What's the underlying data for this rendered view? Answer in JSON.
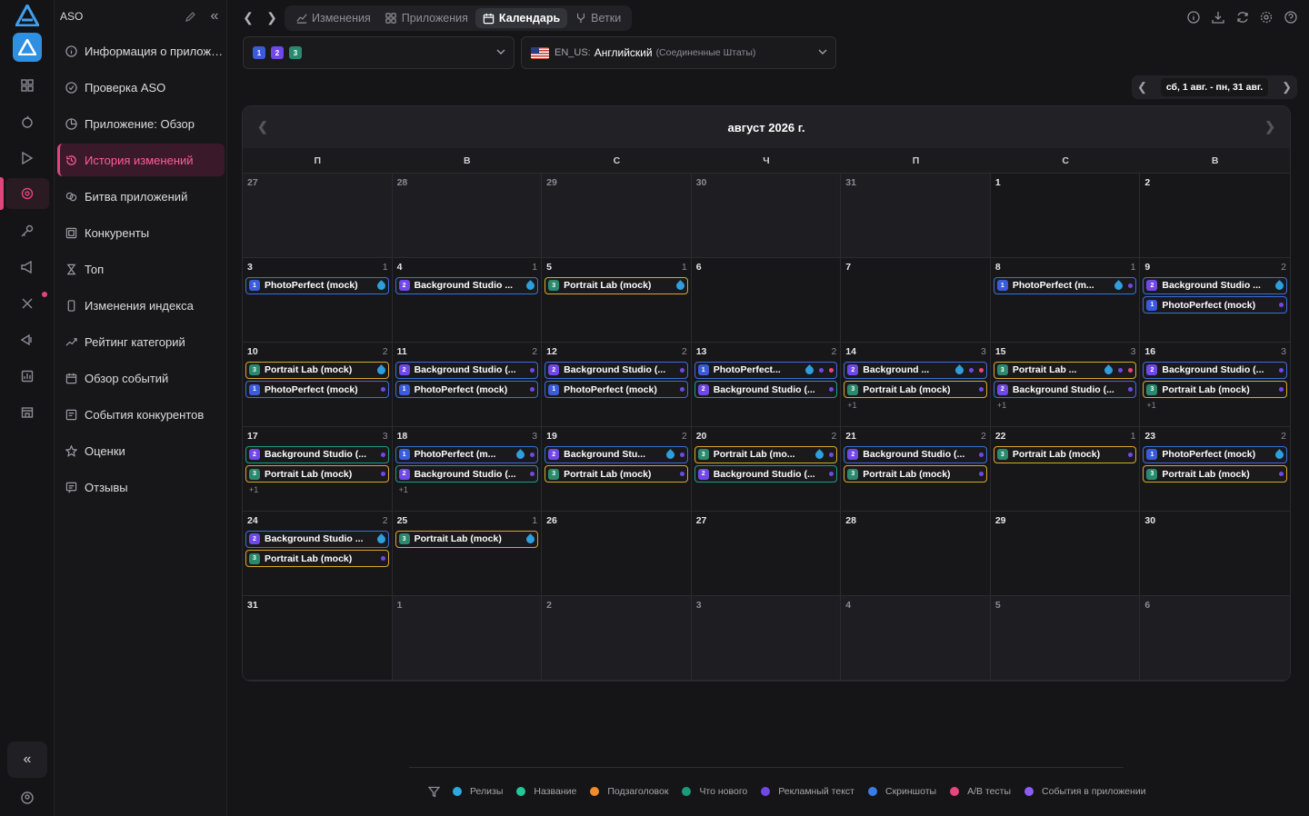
{
  "sidebar": {
    "title": "ASO",
    "items": [
      {
        "label": "Информация о приложен...",
        "icon": "info-icon"
      },
      {
        "label": "Проверка ASO",
        "icon": "check-circle-icon"
      },
      {
        "label": "Приложение: Обзор",
        "icon": "pie-icon"
      },
      {
        "label": "История изменений",
        "icon": "history-icon",
        "active": true
      },
      {
        "label": "Битва приложений",
        "icon": "battle-icon"
      },
      {
        "label": "Конкуренты",
        "icon": "competitors-icon"
      },
      {
        "label": "Топ",
        "icon": "trophy-icon"
      },
      {
        "label": "Изменения индекса",
        "icon": "phone-icon"
      },
      {
        "label": "Рейтинг категорий",
        "icon": "trend-icon"
      },
      {
        "label": "Обзор событий",
        "icon": "calendar-icon"
      },
      {
        "label": "События конкурентов",
        "icon": "events-icon"
      },
      {
        "label": "Оценки",
        "icon": "star-icon"
      },
      {
        "label": "Отзывы",
        "icon": "reviews-icon"
      }
    ]
  },
  "tabs": [
    {
      "label": "Изменения",
      "icon": "changes-icon"
    },
    {
      "label": "Приложения",
      "icon": "apps-icon"
    },
    {
      "label": "Календарь",
      "icon": "calendar-icon",
      "active": true
    },
    {
      "label": "Ветки",
      "icon": "branch-icon"
    }
  ],
  "app_select": {
    "badges": [
      "1",
      "2",
      "3"
    ]
  },
  "locale_select": {
    "code": "EN_US:",
    "language": "Английский",
    "region": "(Соединенные Штаты)"
  },
  "date_range": "сб, 1 авг. - пн, 31 авг.",
  "calendar": {
    "month_title": "август 2026 г.",
    "weekdays": [
      "П",
      "В",
      "С",
      "Ч",
      "П",
      "С",
      "В"
    ],
    "days": [
      {
        "d": "27",
        "other": true
      },
      {
        "d": "28",
        "other": true
      },
      {
        "d": "29",
        "other": true
      },
      {
        "d": "30",
        "other": true
      },
      {
        "d": "31",
        "other": true
      },
      {
        "d": "1"
      },
      {
        "d": "2"
      },
      {
        "d": "3",
        "count": "1",
        "events": [
          {
            "n": "1",
            "t": "PhotoPerfect (mock)",
            "c": "blue",
            "drop": true
          }
        ]
      },
      {
        "d": "4",
        "count": "1",
        "events": [
          {
            "n": "2",
            "t": "Background Studio ...",
            "c": "blue",
            "drop": true
          }
        ]
      },
      {
        "d": "5",
        "count": "1",
        "events": [
          {
            "n": "3",
            "t": "Portrait Lab (mock)",
            "c": "yellow",
            "drop": true
          }
        ]
      },
      {
        "d": "6"
      },
      {
        "d": "7"
      },
      {
        "d": "8",
        "count": "1",
        "events": [
          {
            "n": "1",
            "t": "PhotoPerfect (m...",
            "c": "blue",
            "drop": true,
            "dots": [
              "#7048e8"
            ]
          }
        ]
      },
      {
        "d": "9",
        "count": "2",
        "events": [
          {
            "n": "2",
            "t": "Background Studio ...",
            "c": "blue",
            "drop": true
          },
          {
            "n": "1",
            "t": "PhotoPerfect (mock)",
            "c": "blue",
            "dots": [
              "#7048e8"
            ]
          }
        ]
      },
      {
        "d": "10",
        "count": "2",
        "events": [
          {
            "n": "3",
            "t": "Portrait Lab (mock)",
            "c": "yellow",
            "drop": true
          },
          {
            "n": "1",
            "t": "PhotoPerfect (mock)",
            "c": "blue",
            "dots": [
              "#7048e8"
            ]
          }
        ]
      },
      {
        "d": "11",
        "count": "2",
        "events": [
          {
            "n": "2",
            "t": "Background Studio (...",
            "c": "blue",
            "dots": [
              "#7048e8"
            ]
          },
          {
            "n": "1",
            "t": "PhotoPerfect (mock)",
            "c": "blue",
            "dots": [
              "#7048e8"
            ]
          }
        ]
      },
      {
        "d": "12",
        "count": "2",
        "events": [
          {
            "n": "2",
            "t": "Background Studio (...",
            "c": "blue",
            "dots": [
              "#7048e8"
            ]
          },
          {
            "n": "1",
            "t": "PhotoPerfect (mock)",
            "c": "blue",
            "dots": [
              "#7048e8"
            ]
          }
        ]
      },
      {
        "d": "13",
        "count": "2",
        "events": [
          {
            "n": "1",
            "t": "PhotoPerfect...",
            "c": "blue",
            "drop": true,
            "dots": [
              "#7048e8",
              "#e8457c"
            ]
          },
          {
            "n": "2",
            "t": "Background Studio (...",
            "c": "teal",
            "dots": [
              "#7048e8"
            ]
          }
        ]
      },
      {
        "d": "14",
        "count": "3",
        "more": "+1",
        "events": [
          {
            "n": "2",
            "t": "Background ...",
            "c": "blue",
            "drop": true,
            "dots": [
              "#7048e8",
              "#e8457c"
            ]
          },
          {
            "n": "3",
            "t": "Portrait Lab (mock)",
            "c": "yellow",
            "dots": [
              "#7048e8"
            ]
          }
        ]
      },
      {
        "d": "15",
        "count": "3",
        "more": "+1",
        "events": [
          {
            "n": "3",
            "t": "Portrait Lab ...",
            "c": "yellow",
            "drop": true,
            "dots": [
              "#7048e8",
              "#e8457c"
            ]
          },
          {
            "n": "2",
            "t": "Background Studio (...",
            "c": "blue",
            "dots": [
              "#7048e8"
            ]
          }
        ]
      },
      {
        "d": "16",
        "count": "3",
        "more": "+1",
        "events": [
          {
            "n": "2",
            "t": "Background Studio (...",
            "c": "blue",
            "dots": [
              "#7048e8"
            ]
          },
          {
            "n": "3",
            "t": "Portrait Lab (mock)",
            "c": "yellow",
            "dots": [
              "#7048e8"
            ]
          }
        ]
      },
      {
        "d": "17",
        "count": "3",
        "more": "+1",
        "events": [
          {
            "n": "2",
            "t": "Background Studio (...",
            "c": "teal",
            "dots": [
              "#7048e8"
            ]
          },
          {
            "n": "3",
            "t": "Portrait Lab (mock)",
            "c": "yellow",
            "dots": [
              "#7048e8"
            ]
          }
        ]
      },
      {
        "d": "18",
        "count": "3",
        "more": "+1",
        "events": [
          {
            "n": "1",
            "t": "PhotoPerfect (m...",
            "c": "blue",
            "drop": true,
            "dots": [
              "#7048e8"
            ]
          },
          {
            "n": "2",
            "t": "Background Studio (...",
            "c": "teal",
            "dots": [
              "#7048e8"
            ]
          }
        ]
      },
      {
        "d": "19",
        "count": "2",
        "events": [
          {
            "n": "2",
            "t": "Background Stu...",
            "c": "blue",
            "drop": true,
            "dots": [
              "#7048e8"
            ]
          },
          {
            "n": "3",
            "t": "Portrait Lab (mock)",
            "c": "yellow",
            "dots": [
              "#7048e8"
            ]
          }
        ]
      },
      {
        "d": "20",
        "count": "2",
        "events": [
          {
            "n": "3",
            "t": "Portrait Lab (mo...",
            "c": "yellow",
            "drop": true,
            "dots": [
              "#7048e8"
            ]
          },
          {
            "n": "2",
            "t": "Background Studio (...",
            "c": "teal",
            "dots": [
              "#7048e8"
            ]
          }
        ]
      },
      {
        "d": "21",
        "count": "2",
        "events": [
          {
            "n": "2",
            "t": "Background Studio (...",
            "c": "blue",
            "dots": [
              "#7048e8"
            ]
          },
          {
            "n": "3",
            "t": "Portrait Lab (mock)",
            "c": "yellow",
            "dots": [
              "#7048e8"
            ]
          }
        ]
      },
      {
        "d": "22",
        "count": "1",
        "events": [
          {
            "n": "3",
            "t": "Portrait Lab (mock)",
            "c": "yellow",
            "dots": [
              "#7048e8"
            ]
          }
        ]
      },
      {
        "d": "23",
        "count": "2",
        "events": [
          {
            "n": "1",
            "t": "PhotoPerfect (mock)",
            "c": "blue",
            "drop": true
          },
          {
            "n": "3",
            "t": "Portrait Lab (mock)",
            "c": "yellow",
            "dots": [
              "#7048e8"
            ]
          }
        ]
      },
      {
        "d": "24",
        "count": "2",
        "events": [
          {
            "n": "2",
            "t": "Background Studio ...",
            "c": "blue",
            "drop": true
          },
          {
            "n": "3",
            "t": "Portrait Lab (mock)",
            "c": "yellow",
            "dots": [
              "#7048e8"
            ]
          }
        ]
      },
      {
        "d": "25",
        "count": "1",
        "events": [
          {
            "n": "3",
            "t": "Portrait Lab (mock)",
            "c": "yellow",
            "drop": true
          }
        ]
      },
      {
        "d": "26"
      },
      {
        "d": "27"
      },
      {
        "d": "28"
      },
      {
        "d": "29"
      },
      {
        "d": "30"
      },
      {
        "d": "31"
      },
      {
        "d": "1",
        "other": true
      },
      {
        "d": "2",
        "other": true
      },
      {
        "d": "3",
        "other": true
      },
      {
        "d": "4",
        "other": true
      },
      {
        "d": "5",
        "other": true
      },
      {
        "d": "6",
        "other": true
      }
    ]
  },
  "legend": [
    {
      "label": "Релизы",
      "color": "#2ea8e0"
    },
    {
      "label": "Название",
      "color": "#20c997"
    },
    {
      "label": "Подзаголовок",
      "color": "#f08c2c"
    },
    {
      "label": "Что нового",
      "color": "#1a9c7a"
    },
    {
      "label": "Рекламный текст",
      "color": "#7048e8"
    },
    {
      "label": "Скриншоты",
      "color": "#3b7be8"
    },
    {
      "label": "A/B тесты",
      "color": "#e8457c"
    },
    {
      "label": "События в приложении",
      "color": "#8b5cf6"
    }
  ],
  "colors": {
    "accent": "#e0457c",
    "border_blue": "#3b6fd8",
    "border_yellow": "#d9a72a",
    "border_teal": "#1f9c8a"
  }
}
